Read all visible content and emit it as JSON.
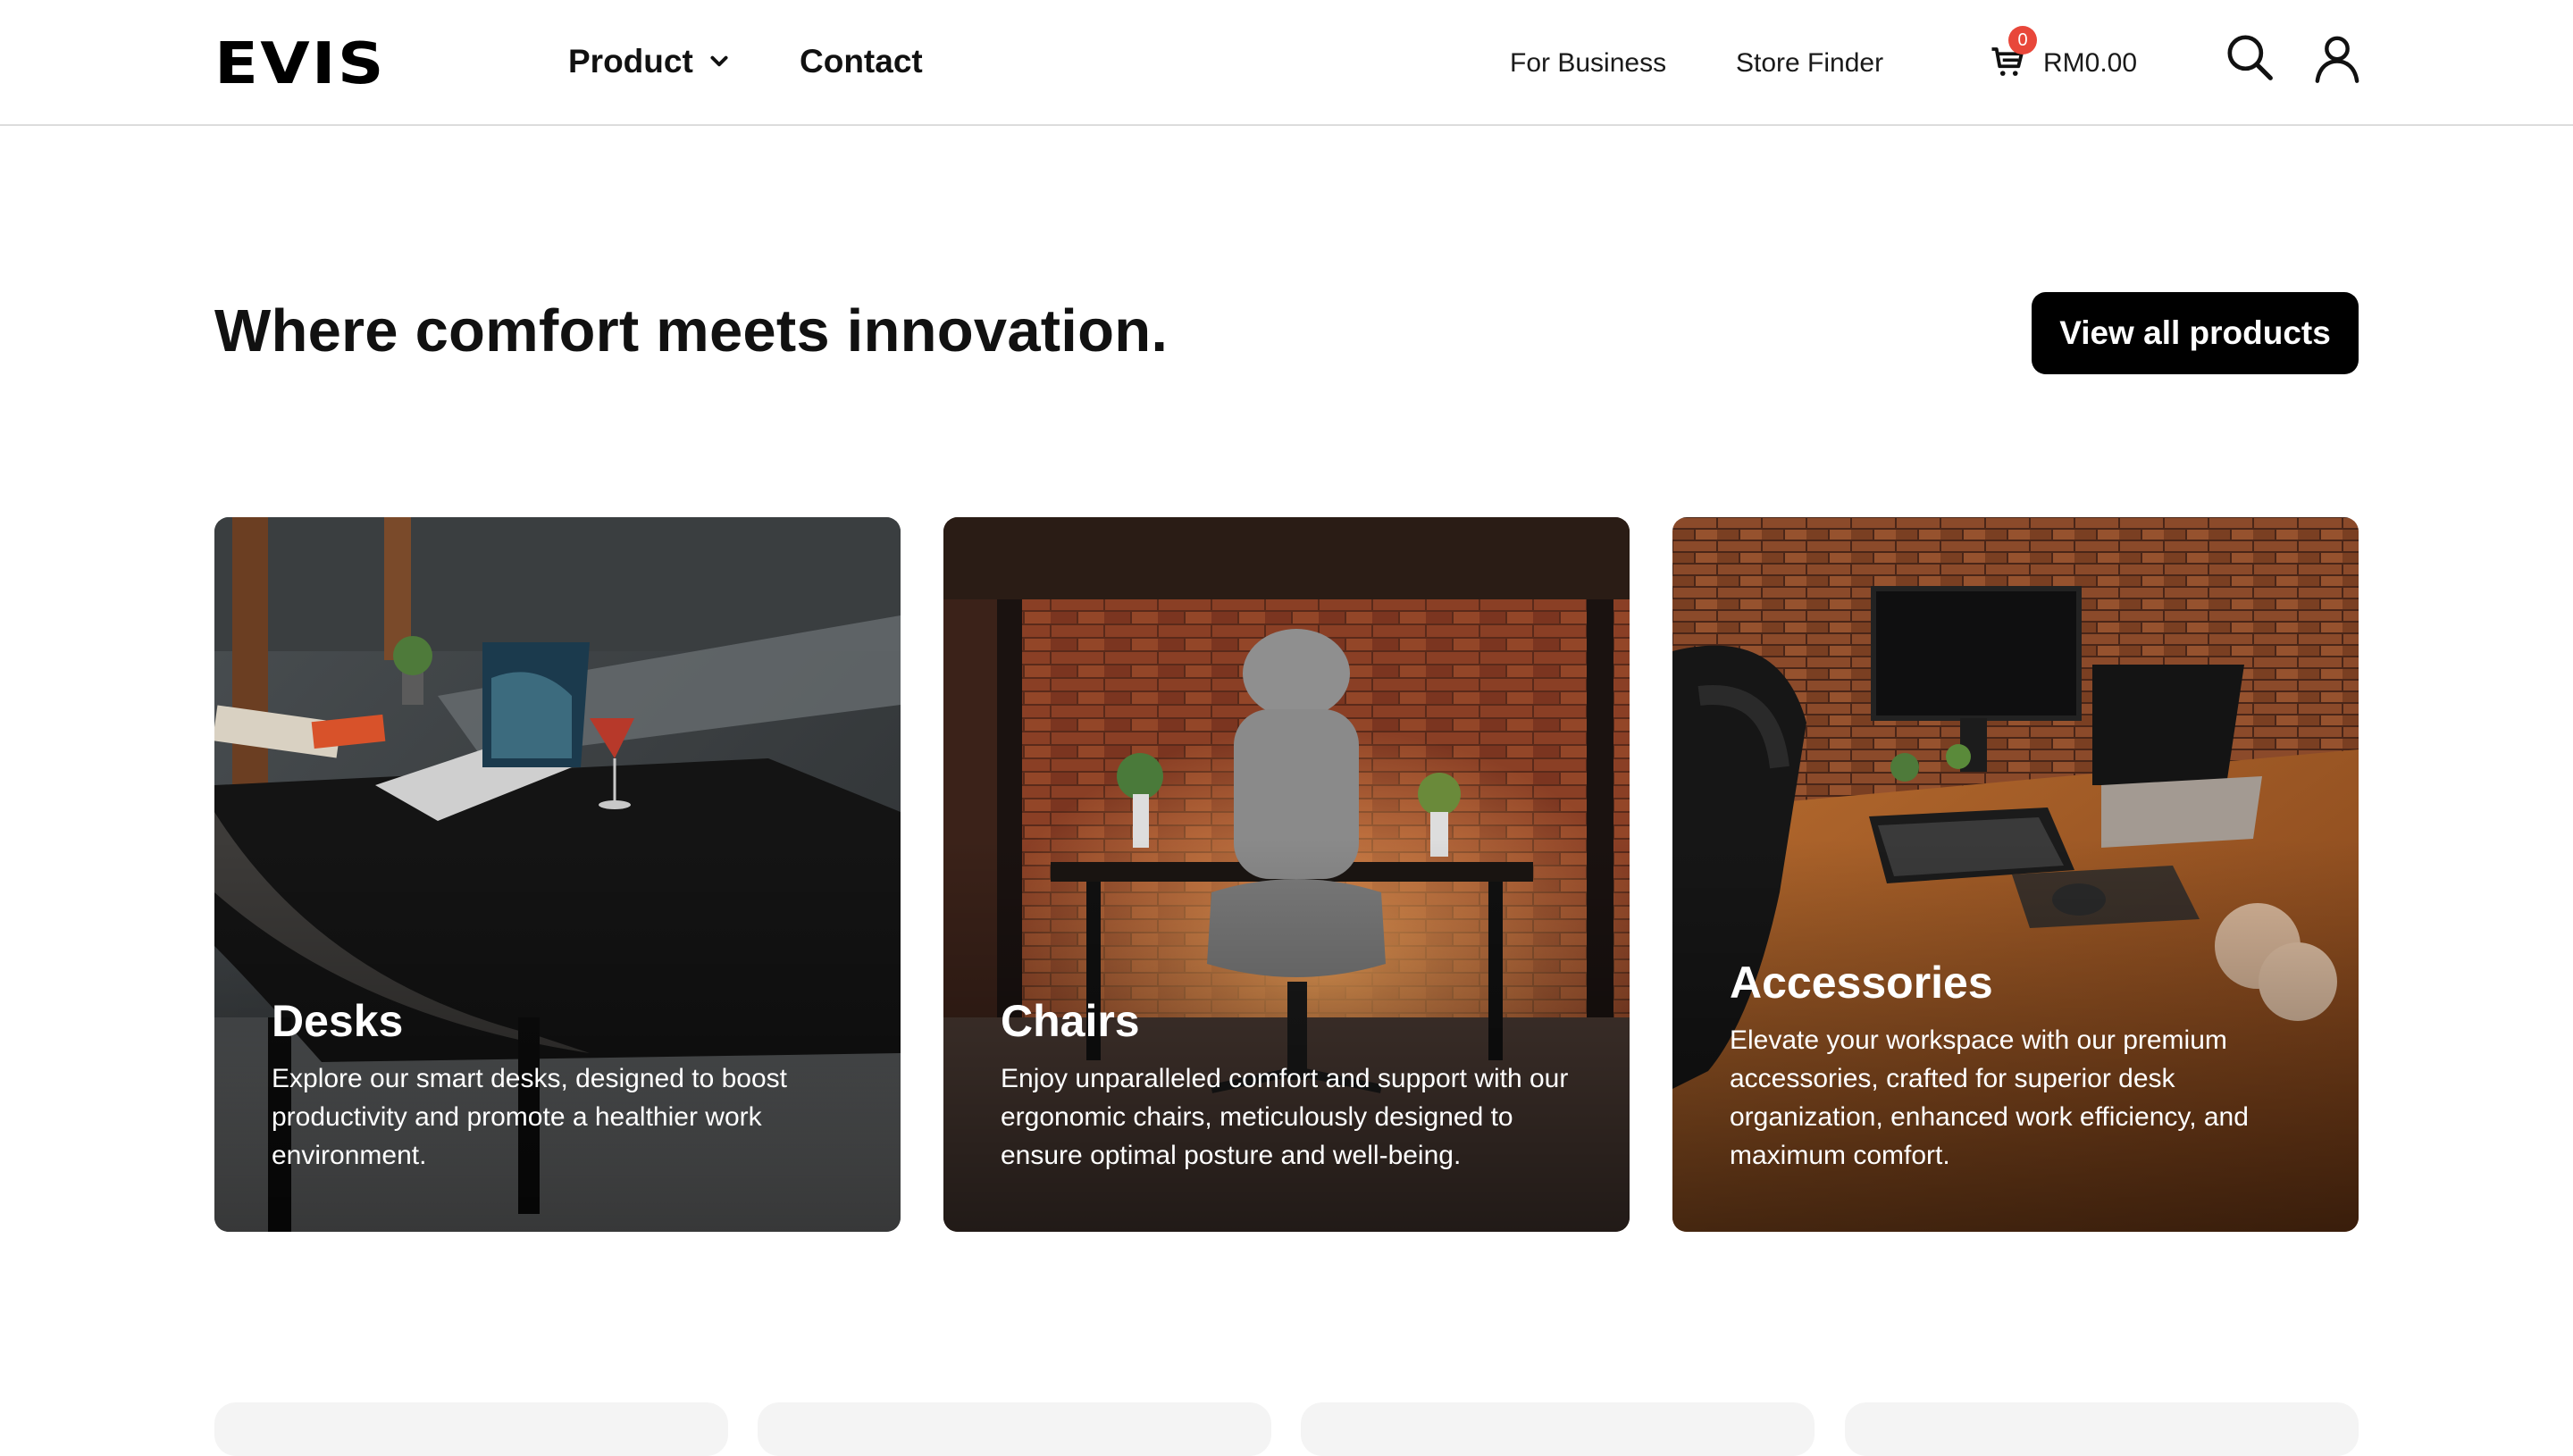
{
  "header": {
    "logo": "EVIS",
    "nav": {
      "product": "Product",
      "contact": "Contact",
      "for_business": "For Business",
      "store_finder": "Store Finder"
    },
    "cart": {
      "count": "0",
      "total": "RM0.00"
    },
    "icons": [
      "cart-icon",
      "search-icon",
      "user-icon",
      "chevron-down-icon"
    ]
  },
  "hero": {
    "headline": "Where comfort meets innovation.",
    "cta": "View all products"
  },
  "categories": [
    {
      "title": "Desks",
      "description": "Explore our smart desks, designed to boost productivity and promote a healthier work environment."
    },
    {
      "title": "Chairs",
      "description": "Enjoy unparalleled comfort and support with our ergonomic chairs, meticulously designed to ensure optimal posture and well-being."
    },
    {
      "title": "Accessories",
      "description": "Elevate your workspace with our premium accessories, crafted for superior desk organization, enhanced work efficiency, and maximum comfort."
    }
  ],
  "theme": {
    "primary": "#000000",
    "badge": "#e8473a",
    "divider": "#dcdcdc"
  }
}
